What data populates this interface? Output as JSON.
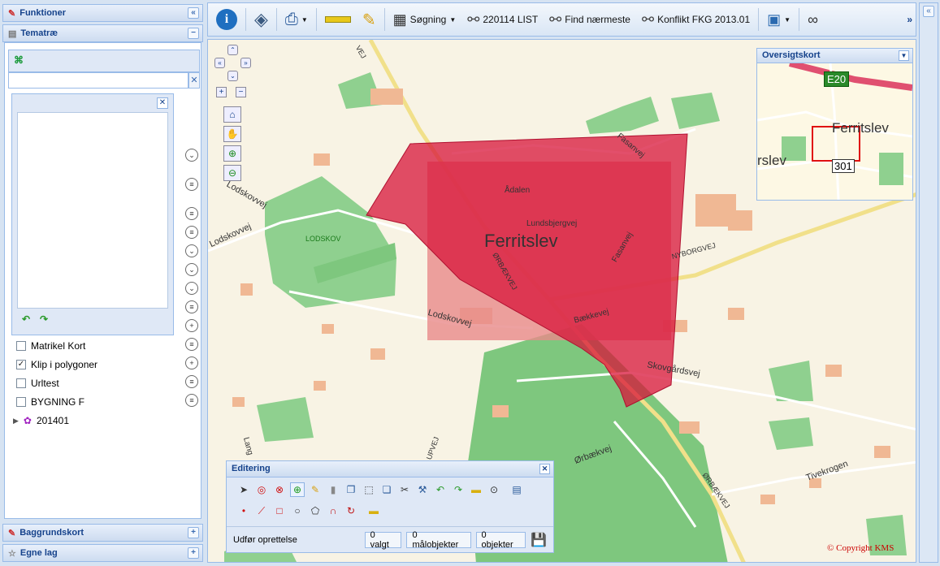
{
  "left_panel": {
    "functions_title": "Funktioner",
    "theme_title": "Tematræ",
    "search_placeholder": "",
    "background_title": "Baggrundskort",
    "own_layers_title": "Egne lag"
  },
  "layers": [
    {
      "label": "Matrikel Kort",
      "checked": false
    },
    {
      "label": "Klip i polygoner",
      "checked": true
    },
    {
      "label": "Urltest",
      "checked": false
    },
    {
      "label": "BYGNING F",
      "checked": false
    }
  ],
  "group_node": {
    "label": "201401"
  },
  "toolbar": {
    "search_label": "Søgning",
    "list_label": "220114 LIST",
    "nearest_label": "Find nærmeste",
    "conflict_label": "Konflikt FKG 2013.01",
    "more_label": "»"
  },
  "overview": {
    "title": "Oversigtskort",
    "road_badge": "E20",
    "place1": "Ferritslev",
    "place2": "rslev",
    "road_number": "301"
  },
  "map_labels": {
    "town": "Ferritslev",
    "lodskov": "LODSKOV",
    "lodskovvej": "Lodskovvej",
    "lodskovvej2": "Lodskovvej",
    "lodskovvej3": "Lodskovvej",
    "aadalen": "Ådalen",
    "lundsbjergvej": "Lundsbjergvej",
    "faesanvej": "Fasanvej",
    "faesanvej2": "Fasanvej",
    "baekkevej": "Bækkevej",
    "orbaekvej": "ØRBÆKVEJ",
    "orbaekvej2": "Ørbækvej",
    "orbaekvej3": "ØRBÆKVEJ",
    "nyborgvej": "NYBORGVEJ",
    "skovgaardsvej": "Skovgårdsvej",
    "tivekrogen": "Tivekrogen",
    "copyright": "© Copyright KMS",
    "lang": "Lang",
    "upvej": "UPVEJ",
    "vej": "VEJ"
  },
  "edit_panel": {
    "title": "Editering",
    "status": "Udfør oprettelse",
    "selected": "0 valgt",
    "target_objects": "0 målobjekter",
    "objects": "0 objekter"
  },
  "colors": {
    "polygon": "#d8143a",
    "green": "#7cc97e",
    "road": "#f1e08a"
  }
}
